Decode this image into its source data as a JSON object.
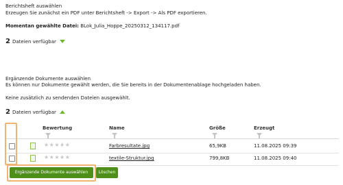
{
  "report_section": {
    "title": "Berichtsheft auswählen",
    "instruction": "Erzeugen Sie zunächst ein PDF unter Berichtsheft -> Export -> Als PDF exportieren.",
    "selected_label": "Momentan gewählte Datei:",
    "selected_file": "BLok_Julia_Hoppe_20250312_134117.pdf",
    "count_number": "2",
    "count_text": "Dateien verfügbar"
  },
  "supplement_section": {
    "title": "Ergänzende Dokumente auswählen",
    "description": "Es können nur Dokumente gewählt werden, die Sie bereits in der Dokumentenablage hochgeladen haben.",
    "status": "Keine zusätzlich zu sendenden Dateien ausgewählt.",
    "count_number": "2",
    "count_text": "Dateien verfügbar"
  },
  "table": {
    "headers": {
      "rating": "Bewertung",
      "name": "Name",
      "size": "Größe",
      "created": "Erzeugt"
    },
    "rows": [
      {
        "stars": "★★★★★",
        "rating": 0,
        "name": "Farbresultate.jpg",
        "size": "65,9KB",
        "created": "11.08.2025 09:39"
      },
      {
        "stars": "★★★★★",
        "rating": 0,
        "name": "textile-Struktur.jpg",
        "size": "799,8KB",
        "created": "11.08.2025 09:40"
      }
    ]
  },
  "buttons": {
    "select_label": "Ergänzende Dokumente auswählen",
    "delete_label": "Löschen"
  },
  "colors": {
    "accent_green": "#4e8f1a",
    "indicator_green": "#6dbb2d",
    "highlight_orange": "#f2b36f"
  }
}
